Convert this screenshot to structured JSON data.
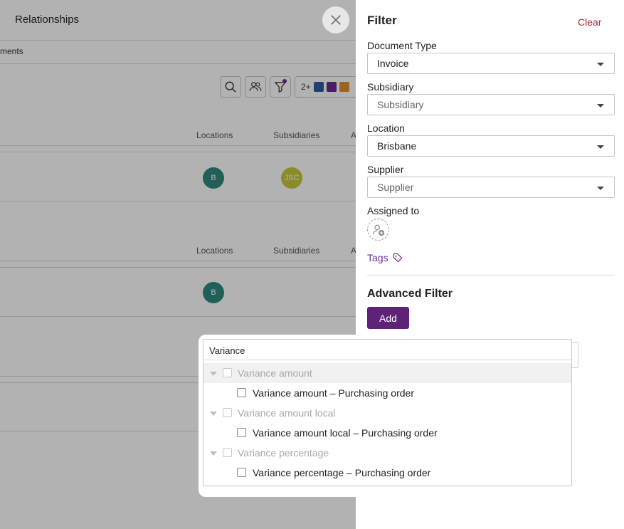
{
  "background": {
    "title": "Relationships",
    "subtitle_fragment": "ments",
    "swatch_count_label": "2+",
    "swatch_colors": [
      "#2b5f9a",
      "#6b2c91",
      "#e0902d"
    ],
    "table1": {
      "headers": [
        "Locations",
        "Subsidiaries",
        "A"
      ],
      "row": {
        "location_avatar": "B",
        "subsidiary_avatar": "JSC"
      }
    },
    "table2": {
      "headers": [
        "Locations",
        "Subsidiaries",
        "A"
      ],
      "row": {
        "location_avatar": "B"
      }
    },
    "avatar_colors": {
      "location": "#2f8a80",
      "subsidiary": "#c8c83a"
    }
  },
  "filter_panel": {
    "title": "Filter",
    "clear_label": "Clear",
    "fields": [
      {
        "label": "Document Type",
        "value": "Invoice",
        "is_placeholder": false
      },
      {
        "label": "Subsidiary",
        "value": "Subsidiary",
        "is_placeholder": true
      },
      {
        "label": "Location",
        "value": "Brisbane",
        "is_placeholder": false
      },
      {
        "label": "Supplier",
        "value": "Supplier",
        "is_placeholder": true
      }
    ],
    "assigned_to_label": "Assigned to",
    "tags_label": "Tags",
    "advanced_filter_title": "Advanced Filter",
    "add_button_label": "Add"
  },
  "dropdown": {
    "search_value": "Variance",
    "options": [
      {
        "label": "Variance amount",
        "level": "parent",
        "highlighted": true
      },
      {
        "label": "Variance amount – Purchasing order",
        "level": "child"
      },
      {
        "label": "Variance amount local",
        "level": "parent"
      },
      {
        "label": "Variance amount local – Purchasing order",
        "level": "child"
      },
      {
        "label": "Variance percentage",
        "level": "parent"
      },
      {
        "label": "Variance percentage – Purchasing order",
        "level": "child"
      }
    ]
  },
  "colors": {
    "accent_purple": "#5e2377",
    "clear_red": "#a32a3a",
    "tags_purple": "#6b2c91"
  }
}
